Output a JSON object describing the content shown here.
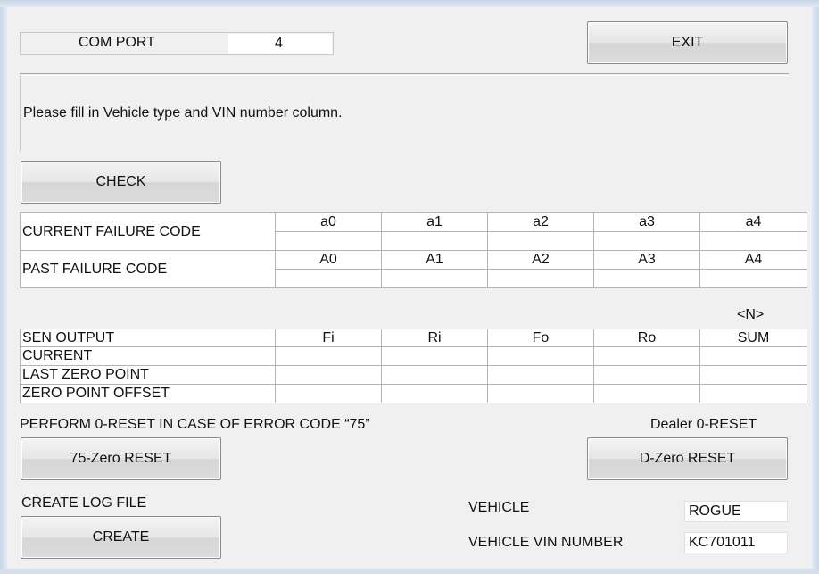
{
  "com_port": {
    "label": "COM PORT",
    "value": "4"
  },
  "toolbar": {
    "exit_label": "EXIT",
    "check_label": "CHECK"
  },
  "message": "Please fill in Vehicle type and VIN number column.",
  "failure_table": {
    "rows": [
      {
        "label": "CURRENT FAILURE CODE",
        "codes": [
          "a0",
          "a1",
          "a2",
          "a3",
          "a4"
        ],
        "values": [
          "",
          "",
          "",
          "",
          ""
        ]
      },
      {
        "label": "PAST FAILURE CODE",
        "codes": [
          "A0",
          "A1",
          "A2",
          "A3",
          "A4"
        ],
        "values": [
          "",
          "",
          "",
          "",
          ""
        ]
      }
    ]
  },
  "sensor_table": {
    "unit": "<N>",
    "header": [
      "SEN OUTPUT",
      "Fi",
      "Ri",
      "Fo",
      "Ro",
      "SUM"
    ],
    "rows": [
      {
        "label": "CURRENT",
        "values": [
          "",
          "",
          "",
          "",
          ""
        ]
      },
      {
        "label": "LAST ZERO POINT",
        "values": [
          "",
          "",
          "",
          "",
          ""
        ]
      },
      {
        "label": "ZERO POINT OFFSET",
        "values": [
          "",
          "",
          "",
          "",
          ""
        ]
      }
    ]
  },
  "reset": {
    "note": "PERFORM 0-RESET IN CASE OF ERROR CODE “75”",
    "dealer_label": "Dealer 0-RESET",
    "zero75_label": "75-Zero RESET",
    "dzero_label": "D-Zero RESET"
  },
  "log": {
    "title": "CREATE LOG FILE",
    "create_label": "CREATE"
  },
  "vehicle": {
    "vehicle_label": "VEHICLE",
    "vehicle_value": "ROGUE",
    "vin_label": "VEHICLE VIN NUMBER",
    "vin_value": "KC701011"
  }
}
